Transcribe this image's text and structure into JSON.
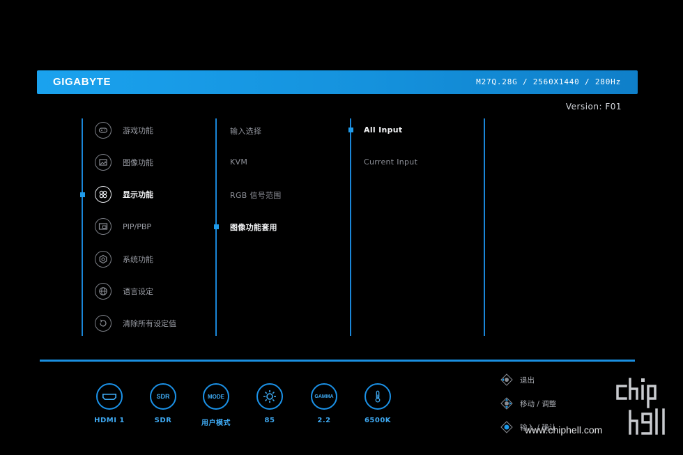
{
  "header": {
    "brand": "GIGABYTE",
    "model_info": "M27Q.28G  /  2560X1440  /  280Hz"
  },
  "version": "Version: F01",
  "menu": {
    "items": [
      {
        "label": "游戏功能",
        "icon": "gamepad-icon",
        "active": false
      },
      {
        "label": "图像功能",
        "icon": "picture-icon",
        "active": false
      },
      {
        "label": "显示功能",
        "icon": "display-grid-icon",
        "active": true
      },
      {
        "label": "PIP/PBP",
        "icon": "pip-icon",
        "active": false
      },
      {
        "label": "系统功能",
        "icon": "system-gear-icon",
        "active": false
      },
      {
        "label": "语言设定",
        "icon": "globe-icon",
        "active": false
      },
      {
        "label": "清除所有设定值",
        "icon": "reset-icon",
        "active": false
      }
    ]
  },
  "submenu": {
    "items": [
      {
        "label": "输入选择",
        "active": false
      },
      {
        "label": "KVM",
        "active": false
      },
      {
        "label": "RGB 信号范围",
        "active": false
      },
      {
        "label": "图像功能套用",
        "active": true
      }
    ]
  },
  "options": {
    "items": [
      {
        "label": "All Input",
        "active": true
      },
      {
        "label": "Current Input",
        "active": false
      }
    ]
  },
  "status": [
    {
      "icon_text": "HDMI",
      "label": "HDMI 1",
      "icon": "hdmi-icon"
    },
    {
      "icon_text": "SDR",
      "label": "SDR",
      "icon": "sdr-icon"
    },
    {
      "icon_text": "MODE",
      "label": "用户模式",
      "icon": "mode-icon"
    },
    {
      "icon_text": "",
      "label": "85",
      "icon": "brightness-icon"
    },
    {
      "icon_text": "GAMMA",
      "label": "2.2",
      "icon": "gamma-icon"
    },
    {
      "icon_text": "",
      "label": "6500K",
      "icon": "thermometer-icon"
    }
  ],
  "keys": [
    {
      "label": "退出",
      "icon": "joystick-left-icon"
    },
    {
      "label": "移动 / 调整",
      "icon": "joystick-move-icon"
    },
    {
      "label": "输入 / 确认",
      "icon": "joystick-press-icon"
    }
  ],
  "watermark": "www.chiphell.com",
  "colors": {
    "accent": "#1a8fe0",
    "header": "#1aa2ee",
    "background": "#000000"
  }
}
